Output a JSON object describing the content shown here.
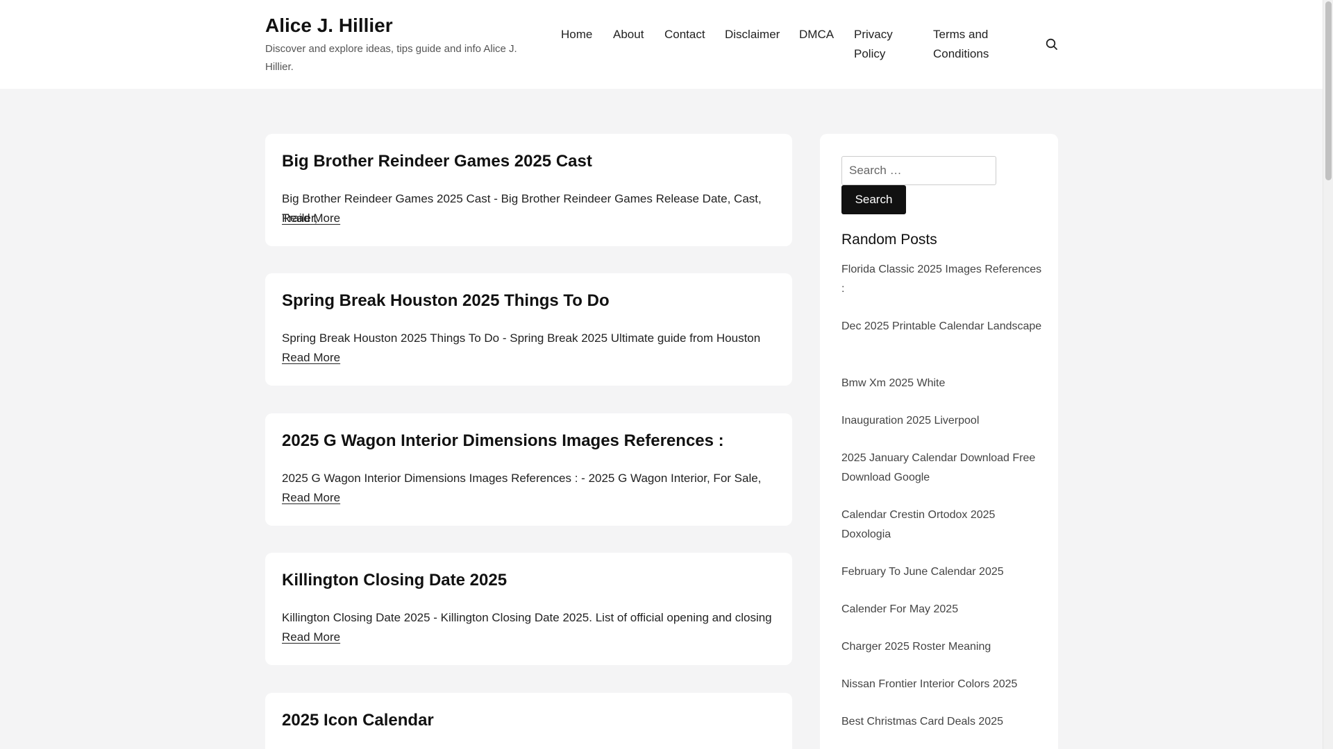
{
  "site": {
    "title": "Alice J. Hillier",
    "description": "Discover and explore ideas, tips guide and info Alice J. Hillier."
  },
  "nav": {
    "items": [
      {
        "label": "Home"
      },
      {
        "label": "About"
      },
      {
        "label": "Contact"
      },
      {
        "label": "Disclaimer"
      },
      {
        "label": "DMCA"
      },
      {
        "label": "Privacy Policy"
      },
      {
        "label": "Terms and Conditions"
      }
    ],
    "search_icon": "search-icon"
  },
  "posts": [
    {
      "title": "Big Brother Reindeer Games 2025 Cast",
      "excerpt": "Big Brother Reindeer Games 2025 Cast - Big Brother Reindeer Games Release Date, Cast, Trailer,",
      "read_more": "Read More"
    },
    {
      "title": "Spring Break Houston 2025 Things To Do",
      "excerpt": "Spring Break Houston 2025 Things To Do - Spring Break 2025 Ultimate guide from Houston",
      "read_more": "Read More"
    },
    {
      "title": "2025 G Wagon Interior Dimensions Images References :",
      "excerpt": "2025 G Wagon Interior Dimensions Images References : - 2025 G Wagon Interior, For Sale,",
      "read_more": "Read More"
    },
    {
      "title": "Killington Closing Date 2025",
      "excerpt": "Killington Closing Date 2025 - Killington Closing Date 2025. List of official opening and closing",
      "read_more": "Read More"
    },
    {
      "title": "2025 Icon Calendar",
      "excerpt": "",
      "read_more": ""
    }
  ],
  "sidebar": {
    "search": {
      "placeholder": "Search …",
      "button_label": "Search"
    },
    "random_posts": {
      "title": "Random Posts",
      "items": [
        "Florida Classic 2025 Images References :",
        "Dec 2025 Printable Calendar Landscape",
        "Bmw Xm 2025 White",
        "Inauguration 2025 Liverpool",
        "2025 January Calendar Download Free Download Google",
        "Calendar Crestin Ortodox 2025 Doxologia",
        "February To June Calendar 2025",
        "Calender For May 2025",
        "Charger 2025 Roster Meaning",
        "Nissan Frontier Interior Colors 2025",
        "Best Christmas Card Deals 2025"
      ]
    }
  }
}
